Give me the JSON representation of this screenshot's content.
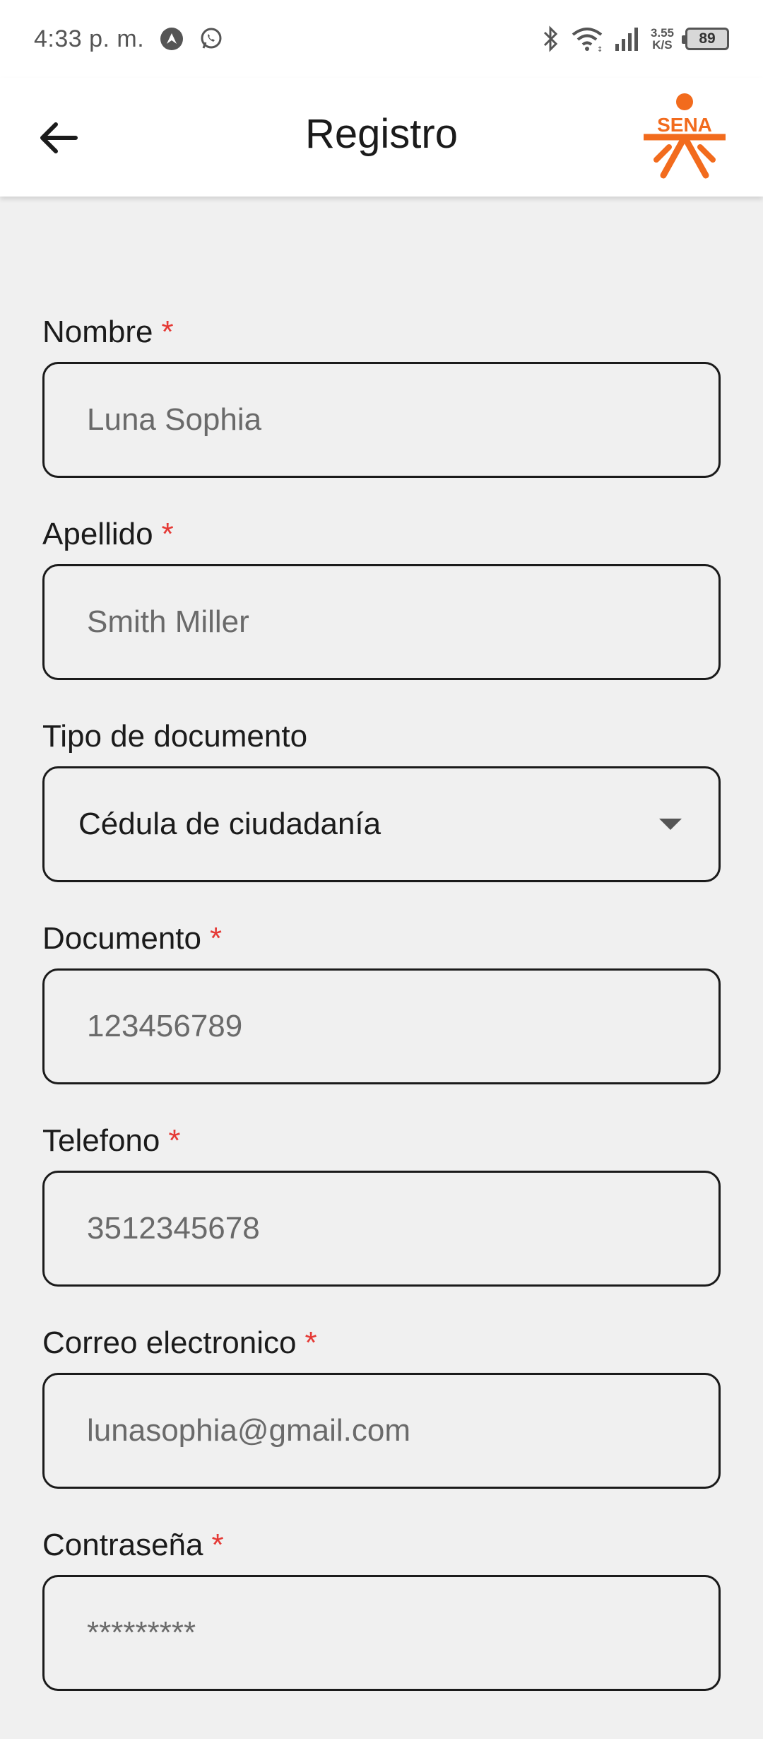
{
  "status_bar": {
    "time": "4:33 p. m.",
    "speed_value": "3.55",
    "speed_unit": "K/S",
    "battery": "89"
  },
  "app_bar": {
    "title": "Registro",
    "logo_text": "SENA",
    "logo_color": "#f26b1d"
  },
  "form": {
    "required_mark": "*",
    "fields": [
      {
        "label": "Nombre",
        "placeholder": "Luna Sophia"
      },
      {
        "label": "Apellido",
        "placeholder": "Smith Miller"
      },
      {
        "label": "Tipo de documento",
        "selected": "Cédula de ciudadanía"
      },
      {
        "label": "Documento",
        "placeholder": "123456789"
      },
      {
        "label": "Telefono",
        "placeholder": "3512345678"
      },
      {
        "label": "Correo electronico",
        "placeholder": "lunasophia@gmail.com"
      },
      {
        "label": "Contraseña",
        "placeholder": "*********"
      }
    ]
  }
}
